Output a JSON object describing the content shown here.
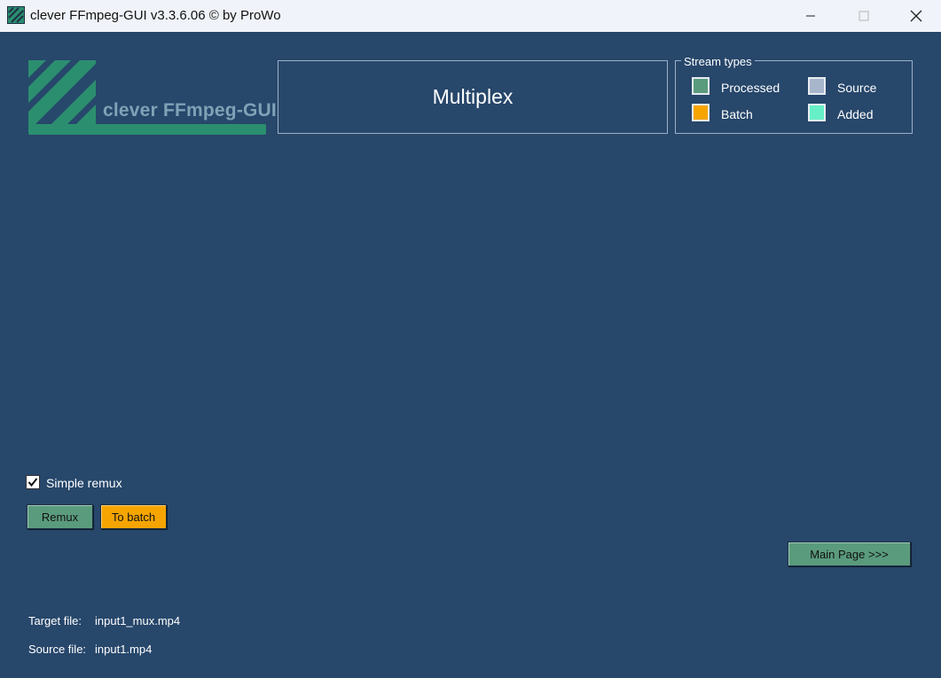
{
  "window": {
    "title": "clever FFmpeg-GUI v3.3.6.06   © by ProWo",
    "controls": {
      "minimize_icon": "minimize-icon",
      "maximize_icon": "maximize-icon",
      "close_icon": "close-icon"
    }
  },
  "logo": {
    "text": "clever FFmpeg-GUI"
  },
  "header": {
    "title": "Multiplex"
  },
  "stream_types": {
    "legend": "Stream types",
    "items": [
      {
        "label": "Processed",
        "color": "#5a9b7d"
      },
      {
        "label": "Source",
        "color": "#a8b6cc"
      },
      {
        "label": "Batch",
        "color": "#f6a500"
      },
      {
        "label": "Added",
        "color": "#67f0c8"
      }
    ]
  },
  "options": {
    "simple_remux_label": "Simple remux",
    "simple_remux_checked": true
  },
  "buttons": {
    "remux": "Remux",
    "to_batch": "To batch",
    "main_page": "Main Page >>>"
  },
  "files": {
    "target_label": "Target file:",
    "target_value": "input1_mux.mp4",
    "source_label": "Source file:",
    "source_value": "input1.mp4"
  },
  "colors": {
    "background": "#27476b",
    "green_button": "#5a9b7d",
    "orange_button": "#f6a500",
    "logo_green": "#2b8f6f"
  }
}
